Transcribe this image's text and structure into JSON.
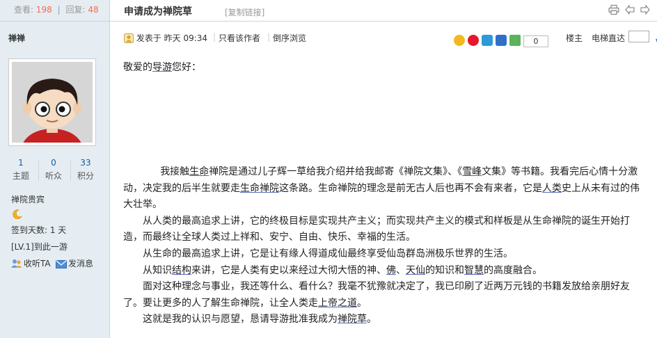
{
  "stats": {
    "views_label": "查看:",
    "views": "198",
    "separator": "|",
    "replies_label": "回复:",
    "replies": "48"
  },
  "author": {
    "name": "禅禅",
    "topics_count": "1",
    "topics_label": "主题",
    "listeners_count": "0",
    "listeners_label": "听众",
    "points_count": "33",
    "points_label": "积分",
    "group": "禅院贵宾",
    "group_icon": "moon-icon",
    "signin": "签到天数: 1 天",
    "level": "[LV.1]到此一游",
    "follow_label": "收听TA",
    "message_label": "发消息"
  },
  "thread": {
    "title": "申请成为禅院草",
    "copy_link": "[复制链接]",
    "toolbar_icons": [
      "print-icon",
      "prev-thread-icon",
      "next-thread-icon"
    ]
  },
  "post": {
    "posted_prefix": "发表于",
    "posted_time": "昨天 09:34",
    "only_author": "只看该作者",
    "reverse_order": "倒序浏览",
    "share_count": "0",
    "floor_label": "楼主",
    "goto_label": "电梯直达",
    "goto_value": ""
  },
  "content": {
    "greet_a": "敬爱的",
    "greet_b": "导游",
    "greet_c": "您好：",
    "p1": [
      "我接触",
      "生命",
      "禅院是通过儿子辉一草给我介绍并给我邮寄《禅院文集》、《",
      "雪峰",
      "文集》等书籍。我看完后心情十分激动，决定我的后半生就要走",
      "生命禅院",
      "这条路。生命禅院的理念是前无古人后也再不会有来者，它是",
      "人类",
      "史上从未有过的伟大壮举。"
    ],
    "p2": "从人类的最高追求上讲，它的终极目标是实现共产主义；而实现共产主义的模式和样板是从生命禅院的诞生开始打造，而最终让全球人类过上祥和、安宁、自由、快乐、幸福的生活。",
    "p3": "从生命的最高追求上讲，它是让有缘人得道成仙最终享受仙岛群岛洲极乐世界的生活。",
    "p4": [
      "从知识",
      "结构",
      "来讲，它是人类有史以来经过大彻大悟的神、",
      "佛",
      "、",
      "天仙",
      "的知识和",
      "智慧",
      "的高度融合。"
    ],
    "p5": [
      "面对这种理念与事业，我还等什么、看什么？我毫不犹豫就决定了，我已印刷了近两万元钱的书籍发放给亲朋好友了。要让更多的人了解生命禅院，让全人类走",
      "上帝之道",
      "。"
    ],
    "p6": [
      "这就是我的认识与愿望，恳请导游批准我成为",
      "禅院草",
      "。"
    ]
  }
}
